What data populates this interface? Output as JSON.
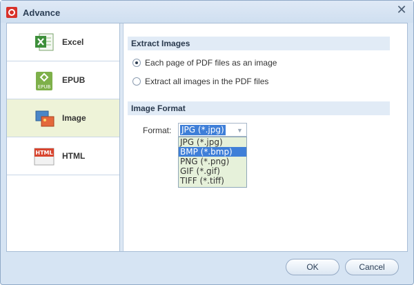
{
  "window": {
    "title": "Advance",
    "close_symbol": "✕"
  },
  "sidebar": {
    "items": [
      {
        "label": "Excel",
        "icon": "excel-icon",
        "active": false
      },
      {
        "label": "EPUB",
        "icon": "epub-icon",
        "active": false
      },
      {
        "label": "Image",
        "icon": "image-icon",
        "active": true
      },
      {
        "label": "HTML",
        "icon": "html-icon",
        "active": false
      }
    ]
  },
  "extract_images": {
    "header": "Extract Images",
    "options": [
      {
        "label": "Each page of PDF files as an image",
        "checked": true
      },
      {
        "label": "Extract all images in the PDF files",
        "checked": false
      }
    ]
  },
  "image_format": {
    "header": "Image Format",
    "format_label": "Format:",
    "selected": "JPG (*.jpg)",
    "options": [
      "JPG (*.jpg)",
      "BMP (*.bmp)",
      "PNG (*.png)",
      "GIF (*.gif)",
      "TIFF (*.tiff)"
    ],
    "highlighted_index": 1
  },
  "buttons": {
    "ok": "OK",
    "cancel": "Cancel"
  },
  "icon_text": {
    "epub": "EPUB",
    "html": "HTML"
  },
  "colors": {
    "accent": "#3f7fd8",
    "active_nav": "#eef3d8",
    "section_header": "#e1ebf6"
  }
}
